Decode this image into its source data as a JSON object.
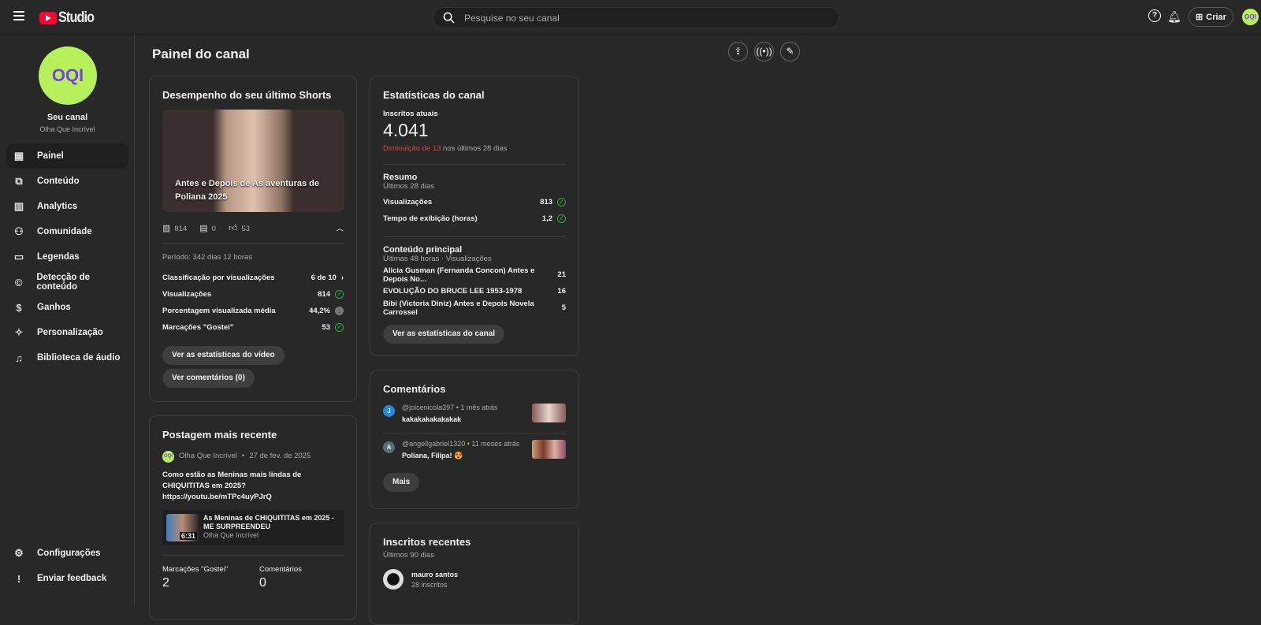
{
  "header": {
    "logo_text": "Studio",
    "search_placeholder": "Pesquise no seu canal",
    "create_label": "Criar",
    "avatar_text": "OQI"
  },
  "sidebar": {
    "channel_label": "Seu canal",
    "channel_name": "Olha Que Incrível",
    "avatar_text": "OQI",
    "items": [
      {
        "label": "Painel",
        "icon": "dashboard-icon"
      },
      {
        "label": "Conteúdo",
        "icon": "content-icon"
      },
      {
        "label": "Analytics",
        "icon": "analytics-icon"
      },
      {
        "label": "Comunidade",
        "icon": "community-icon"
      },
      {
        "label": "Legendas",
        "icon": "subtitles-icon"
      },
      {
        "label": "Detecção de conteúdo",
        "icon": "copyright-icon"
      },
      {
        "label": "Ganhos",
        "icon": "earn-icon"
      },
      {
        "label": "Personalização",
        "icon": "customization-icon"
      },
      {
        "label": "Biblioteca de áudio",
        "icon": "audio-library-icon"
      }
    ],
    "bottom": [
      {
        "label": "Configurações"
      },
      {
        "label": "Enviar feedback"
      }
    ]
  },
  "page": {
    "title": "Painel do canal"
  },
  "shorts": {
    "title": "Desempenho do seu último Shorts",
    "video_title": "Antes e Depois de As aventuras de Poliana 2025",
    "views": "814",
    "comments": "0",
    "likes": "53",
    "period": "Período: 342 dias 12 horas",
    "rows": [
      {
        "label": "Classificação por visualizações",
        "value": "6 de 10"
      },
      {
        "label": "Visualizações",
        "value": "814"
      },
      {
        "label": "Porcentagem visualizada média",
        "value": "44,2%"
      },
      {
        "label": "Marcações \"Gostei\"",
        "value": "53"
      }
    ],
    "btn_stats": "Ver as estatísticas do vídeo",
    "btn_comments": "Ver comentários (0)"
  },
  "post": {
    "title": "Postagem mais recente",
    "author": "Olha Que Incrível",
    "date": "27 de fev. de 2025",
    "text": "Como estão as  Meninas mais lindas de CHIQUITITAS em 2025?",
    "link": "https://youtu.be/mTPc4uyPJrQ",
    "video_title": "As  Meninas de CHIQUITITAS em 2025 - ME SURPREENDEU",
    "video_channel": "Olha Que Incrível",
    "duration": "6:31",
    "likes_label": "Marcações \"Gostei\"",
    "likes": "2",
    "comments_label": "Comentários",
    "comments": "0"
  },
  "stats": {
    "title": "Estatísticas do canal",
    "subs_label": "Inscritos atuais",
    "subs": "4.041",
    "change_red": "Diminuição de 13",
    "change_rest": " nos últimos 28 dias",
    "summary_title": "Resumo",
    "summary_sub": "Últimos 28 dias",
    "summary": [
      {
        "label": "Visualizações",
        "value": "813"
      },
      {
        "label": "Tempo de exibição (horas)",
        "value": "1,2"
      }
    ],
    "top_title": "Conteúdo principal",
    "top_sub": "Últimas 48 horas · Visualizações",
    "top": [
      {
        "label": "Alicia Gusman (Fernanda Concon) Antes e Depois No...",
        "value": "21"
      },
      {
        "label": "EVOLUÇÃO DO BRUCE LEE 1953-1978",
        "value": "16"
      },
      {
        "label": "Bibi (Victoria Diniz) Antes e Depois Novela Carrossel",
        "value": "5"
      }
    ],
    "btn": "Ver as estatísticas do canal"
  },
  "comments": {
    "title": "Comentários",
    "items": [
      {
        "initial": "J",
        "user": "@joicenicola397",
        "time": "• 1 mês atrás",
        "text": "kakakakakakakak",
        "color": "#1e88e5"
      },
      {
        "initial": "A",
        "user": "@angellgabriel1320",
        "time": "• 11 meses atrás",
        "text": "Poliana, Filipa! 😍",
        "color": "#546e7a"
      }
    ],
    "more": "Mais"
  },
  "subs": {
    "title": "Inscritos recentes",
    "sub": "Últimos 90 dias",
    "items": [
      {
        "name": "mauro santos",
        "count": "28 inscritos"
      }
    ]
  }
}
